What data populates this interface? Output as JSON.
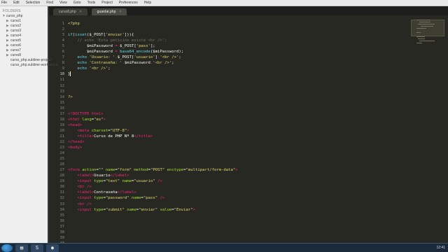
{
  "menubar": {
    "items": [
      "File",
      "Edit",
      "Selection",
      "Find",
      "View",
      "Goto",
      "Tools",
      "Project",
      "Preferences",
      "Help"
    ]
  },
  "sidebar": {
    "header": "FOLDERS",
    "items": [
      {
        "label": "curso_php",
        "arrow": "▼",
        "indent": 0
      },
      {
        "label": "curso1",
        "arrow": "▶",
        "indent": 1
      },
      {
        "label": "curso2",
        "arrow": "▶",
        "indent": 1
      },
      {
        "label": "curso3",
        "arrow": "▶",
        "indent": 1
      },
      {
        "label": "curso4",
        "arrow": "▶",
        "indent": 1
      },
      {
        "label": "curso5",
        "arrow": "▶",
        "indent": 1
      },
      {
        "label": "curso6",
        "arrow": "▶",
        "indent": 1
      },
      {
        "label": "curso7",
        "arrow": "▶",
        "indent": 1
      },
      {
        "label": "curso8",
        "arrow": "▶",
        "indent": 1
      },
      {
        "label": "curso_php.sublime-project",
        "arrow": "",
        "indent": 1
      },
      {
        "label": "curso_php.sublime-workspace",
        "arrow": "",
        "indent": 1
      }
    ]
  },
  "tabs": [
    {
      "label": "curso8.php",
      "active": false,
      "close": "×"
    },
    {
      "label": "guardar.php",
      "active": true,
      "close": "×"
    }
  ],
  "editor": {
    "line_numbers": [
      "1",
      "2",
      "3",
      "4",
      "5",
      "6",
      "7",
      "8",
      "9",
      "10",
      "11",
      "12",
      "13",
      "14",
      "15",
      "16",
      "17",
      "18",
      "19",
      "20",
      "21",
      "22",
      "23",
      "24",
      "25",
      "26",
      "27",
      "28",
      "29",
      "30",
      "31",
      "32",
      "33",
      "34",
      "35",
      "36",
      "37",
      "38",
      "39",
      "40"
    ],
    "cursor_line": 10
  },
  "taskbar": {
    "start_icon": "windows-start-icon",
    "tray_time": "12:41"
  }
}
